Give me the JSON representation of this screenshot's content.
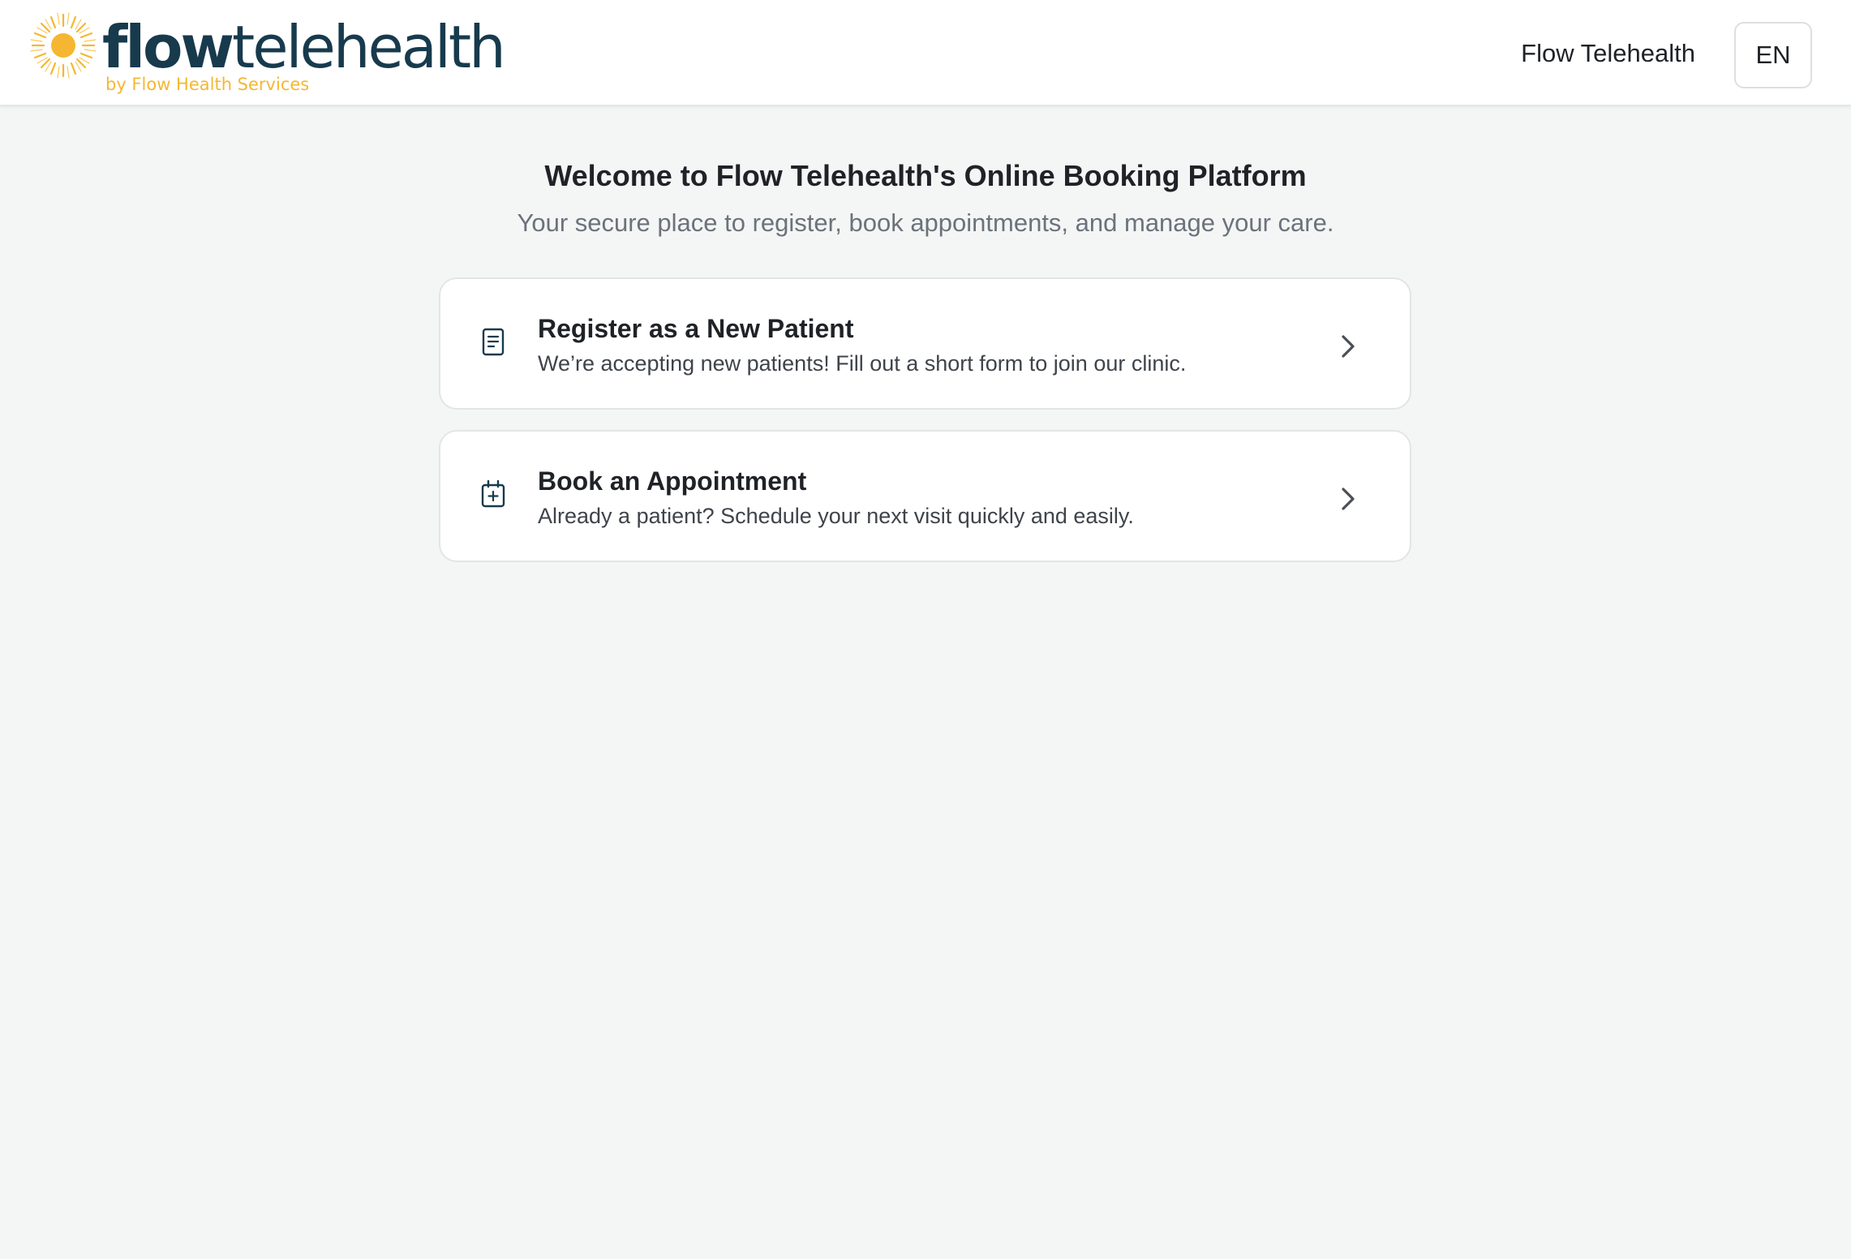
{
  "header": {
    "logo": {
      "word_bold": "flow",
      "word_light": "telehealth",
      "tagline": "by Flow Health Services",
      "sun_color": "#f5b731",
      "word_color": "#173a4d"
    },
    "nav_link": "Flow Telehealth",
    "language": "EN"
  },
  "main": {
    "title": "Welcome to Flow Telehealth's Online Booking Platform",
    "subtitle": "Your secure place to register, book appointments, and manage your care.",
    "cards": [
      {
        "icon": "document-icon",
        "title": "Register as a New Patient",
        "description": "We’re accepting new patients! Fill out a short form to join our clinic."
      },
      {
        "icon": "calendar-plus-icon",
        "title": "Book an Appointment",
        "description": "Already a patient? Schedule your next visit quickly and easily."
      }
    ]
  },
  "colors": {
    "accent": "#173a4d",
    "background": "#f4f6f5",
    "muted_text": "#6b727b"
  }
}
